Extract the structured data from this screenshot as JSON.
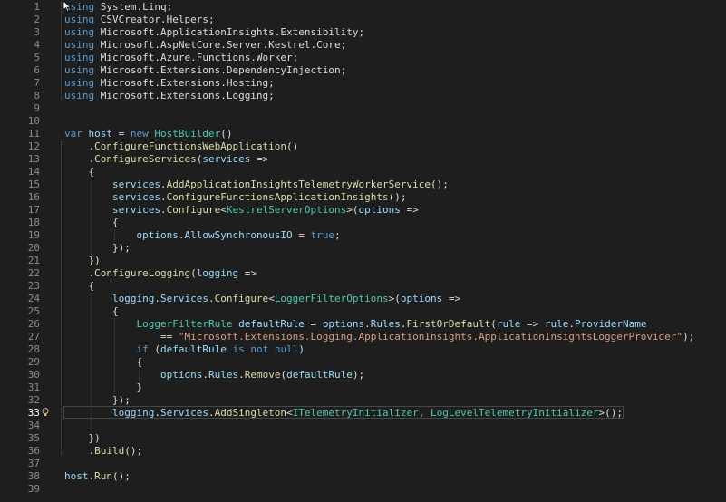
{
  "editor": {
    "current_line": 33,
    "icons": {
      "lightbulb": "lightbulb-icon",
      "mouse_cursor": "mouse-pointer-icon"
    },
    "colors": {
      "background": "#1e1e1e",
      "keyword": "#569cd6",
      "type": "#4ec9b0",
      "method": "#dcdcaa",
      "variable": "#9cdcfe",
      "string": "#d69d85",
      "plain": "#dcdcdc",
      "line_number": "#8a8a8a"
    },
    "lines": [
      {
        "n": "1",
        "tokens": [
          [
            "kw",
            "using"
          ],
          [
            "pl",
            " System.Linq;"
          ]
        ]
      },
      {
        "n": "2",
        "tokens": [
          [
            "kw",
            "using"
          ],
          [
            "pl",
            " CSVCreator.Helpers;"
          ]
        ]
      },
      {
        "n": "3",
        "tokens": [
          [
            "kw",
            "using"
          ],
          [
            "pl",
            " Microsoft.ApplicationInsights.Extensibility;"
          ]
        ]
      },
      {
        "n": "4",
        "tokens": [
          [
            "kw",
            "using"
          ],
          [
            "pl",
            " Microsoft.AspNetCore.Server.Kestrel.Core;"
          ]
        ]
      },
      {
        "n": "5",
        "tokens": [
          [
            "kw",
            "using"
          ],
          [
            "pl",
            " Microsoft.Azure.Functions.Worker;"
          ]
        ]
      },
      {
        "n": "6",
        "tokens": [
          [
            "kw",
            "using"
          ],
          [
            "pl",
            " Microsoft.Extensions.DependencyInjection;"
          ]
        ]
      },
      {
        "n": "7",
        "tokens": [
          [
            "kw",
            "using"
          ],
          [
            "pl",
            " Microsoft.Extensions.Hosting;"
          ]
        ]
      },
      {
        "n": "8",
        "tokens": [
          [
            "kw",
            "using"
          ],
          [
            "pl",
            " Microsoft.Extensions.Logging;"
          ]
        ]
      },
      {
        "n": "9",
        "tokens": []
      },
      {
        "n": "10",
        "tokens": []
      },
      {
        "n": "11",
        "tokens": [
          [
            "kw",
            "var"
          ],
          [
            "pl",
            " "
          ],
          [
            "var",
            "host"
          ],
          [
            "pl",
            " = "
          ],
          [
            "kw",
            "new"
          ],
          [
            "pl",
            " "
          ],
          [
            "type",
            "HostBuilder"
          ],
          [
            "pl",
            "()"
          ]
        ]
      },
      {
        "n": "12",
        "tokens": [
          [
            "pl",
            "    ."
          ],
          [
            "fn",
            "ConfigureFunctionsWebApplication"
          ],
          [
            "pl",
            "()"
          ]
        ]
      },
      {
        "n": "13",
        "tokens": [
          [
            "pl",
            "    ."
          ],
          [
            "fn",
            "ConfigureServices"
          ],
          [
            "pl",
            "("
          ],
          [
            "var",
            "services"
          ],
          [
            "pl",
            " =>"
          ]
        ]
      },
      {
        "n": "14",
        "tokens": [
          [
            "pl",
            "    {"
          ]
        ]
      },
      {
        "n": "15",
        "tokens": [
          [
            "pl",
            "        "
          ],
          [
            "var",
            "services"
          ],
          [
            "pl",
            "."
          ],
          [
            "fn",
            "AddApplicationInsightsTelemetryWorkerService"
          ],
          [
            "pl",
            "();"
          ]
        ]
      },
      {
        "n": "16",
        "tokens": [
          [
            "pl",
            "        "
          ],
          [
            "var",
            "services"
          ],
          [
            "pl",
            "."
          ],
          [
            "fn",
            "ConfigureFunctionsApplicationInsights"
          ],
          [
            "pl",
            "();"
          ]
        ]
      },
      {
        "n": "17",
        "tokens": [
          [
            "pl",
            "        "
          ],
          [
            "var",
            "services"
          ],
          [
            "pl",
            "."
          ],
          [
            "fn",
            "Configure"
          ],
          [
            "pl",
            "<"
          ],
          [
            "type",
            "KestrelServerOptions"
          ],
          [
            "pl",
            ">("
          ],
          [
            "var",
            "options"
          ],
          [
            "pl",
            " =>"
          ]
        ]
      },
      {
        "n": "18",
        "tokens": [
          [
            "pl",
            "        {"
          ]
        ]
      },
      {
        "n": "19",
        "tokens": [
          [
            "pl",
            "            "
          ],
          [
            "var",
            "options"
          ],
          [
            "pl",
            "."
          ],
          [
            "var",
            "AllowSynchronousIO"
          ],
          [
            "pl",
            " = "
          ],
          [
            "kw",
            "true"
          ],
          [
            "pl",
            ";"
          ]
        ]
      },
      {
        "n": "20",
        "tokens": [
          [
            "pl",
            "        });"
          ]
        ]
      },
      {
        "n": "21",
        "tokens": [
          [
            "pl",
            "    })"
          ]
        ]
      },
      {
        "n": "22",
        "tokens": [
          [
            "pl",
            "    ."
          ],
          [
            "fn",
            "ConfigureLogging"
          ],
          [
            "pl",
            "("
          ],
          [
            "var",
            "logging"
          ],
          [
            "pl",
            " =>"
          ]
        ]
      },
      {
        "n": "23",
        "tokens": [
          [
            "pl",
            "    {"
          ]
        ]
      },
      {
        "n": "24",
        "tokens": [
          [
            "pl",
            "        "
          ],
          [
            "var",
            "logging"
          ],
          [
            "pl",
            "."
          ],
          [
            "var",
            "Services"
          ],
          [
            "pl",
            "."
          ],
          [
            "fn",
            "Configure"
          ],
          [
            "pl",
            "<"
          ],
          [
            "type",
            "LoggerFilterOptions"
          ],
          [
            "pl",
            ">("
          ],
          [
            "var",
            "options"
          ],
          [
            "pl",
            " =>"
          ]
        ]
      },
      {
        "n": "25",
        "tokens": [
          [
            "pl",
            "        {"
          ]
        ]
      },
      {
        "n": "26",
        "tokens": [
          [
            "pl",
            "            "
          ],
          [
            "type",
            "LoggerFilterRule"
          ],
          [
            "pl",
            " "
          ],
          [
            "var",
            "defaultRule"
          ],
          [
            "pl",
            " = "
          ],
          [
            "var",
            "options"
          ],
          [
            "pl",
            "."
          ],
          [
            "var",
            "Rules"
          ],
          [
            "pl",
            "."
          ],
          [
            "fn",
            "FirstOrDefault"
          ],
          [
            "pl",
            "("
          ],
          [
            "var",
            "rule"
          ],
          [
            "pl",
            " => "
          ],
          [
            "var",
            "rule"
          ],
          [
            "pl",
            "."
          ],
          [
            "var",
            "ProviderName"
          ]
        ]
      },
      {
        "n": "27",
        "tokens": [
          [
            "pl",
            "                == "
          ],
          [
            "str",
            "\"Microsoft.Extensions.Logging.ApplicationInsights.ApplicationInsightsLoggerProvider\""
          ],
          [
            "pl",
            ");"
          ]
        ]
      },
      {
        "n": "28",
        "tokens": [
          [
            "pl",
            "            "
          ],
          [
            "kw",
            "if"
          ],
          [
            "pl",
            " ("
          ],
          [
            "var",
            "defaultRule"
          ],
          [
            "pl",
            " "
          ],
          [
            "kw",
            "is not null"
          ],
          [
            "pl",
            ")"
          ]
        ]
      },
      {
        "n": "29",
        "tokens": [
          [
            "pl",
            "            {"
          ]
        ]
      },
      {
        "n": "30",
        "tokens": [
          [
            "pl",
            "                "
          ],
          [
            "var",
            "options"
          ],
          [
            "pl",
            "."
          ],
          [
            "var",
            "Rules"
          ],
          [
            "pl",
            "."
          ],
          [
            "fn",
            "Remove"
          ],
          [
            "pl",
            "("
          ],
          [
            "var",
            "defaultRule"
          ],
          [
            "pl",
            ");"
          ]
        ]
      },
      {
        "n": "31",
        "tokens": [
          [
            "pl",
            "            }"
          ]
        ]
      },
      {
        "n": "32",
        "tokens": [
          [
            "pl",
            "        });"
          ]
        ]
      },
      {
        "n": "33",
        "tokens": [
          [
            "pl",
            "        "
          ],
          [
            "var",
            "logging"
          ],
          [
            "pl",
            "."
          ],
          [
            "var",
            "Services"
          ],
          [
            "pl",
            "."
          ],
          [
            "fn",
            "AddSingleton"
          ],
          [
            "pl",
            "<"
          ],
          [
            "type",
            "ITelemetryInitializer"
          ],
          [
            "pl",
            ", "
          ],
          [
            "type",
            "LogLevelTelemetryInitializer"
          ],
          [
            "pl",
            ">();"
          ]
        ]
      },
      {
        "n": "34",
        "tokens": []
      },
      {
        "n": "35",
        "tokens": [
          [
            "pl",
            "    })"
          ]
        ]
      },
      {
        "n": "36",
        "tokens": [
          [
            "pl",
            "    ."
          ],
          [
            "fn",
            "Build"
          ],
          [
            "pl",
            "();"
          ]
        ]
      },
      {
        "n": "37",
        "tokens": []
      },
      {
        "n": "38",
        "tokens": [
          [
            "var",
            "host"
          ],
          [
            "pl",
            "."
          ],
          [
            "fn",
            "Run"
          ],
          [
            "pl",
            "();"
          ]
        ]
      },
      {
        "n": "39",
        "tokens": []
      }
    ]
  }
}
